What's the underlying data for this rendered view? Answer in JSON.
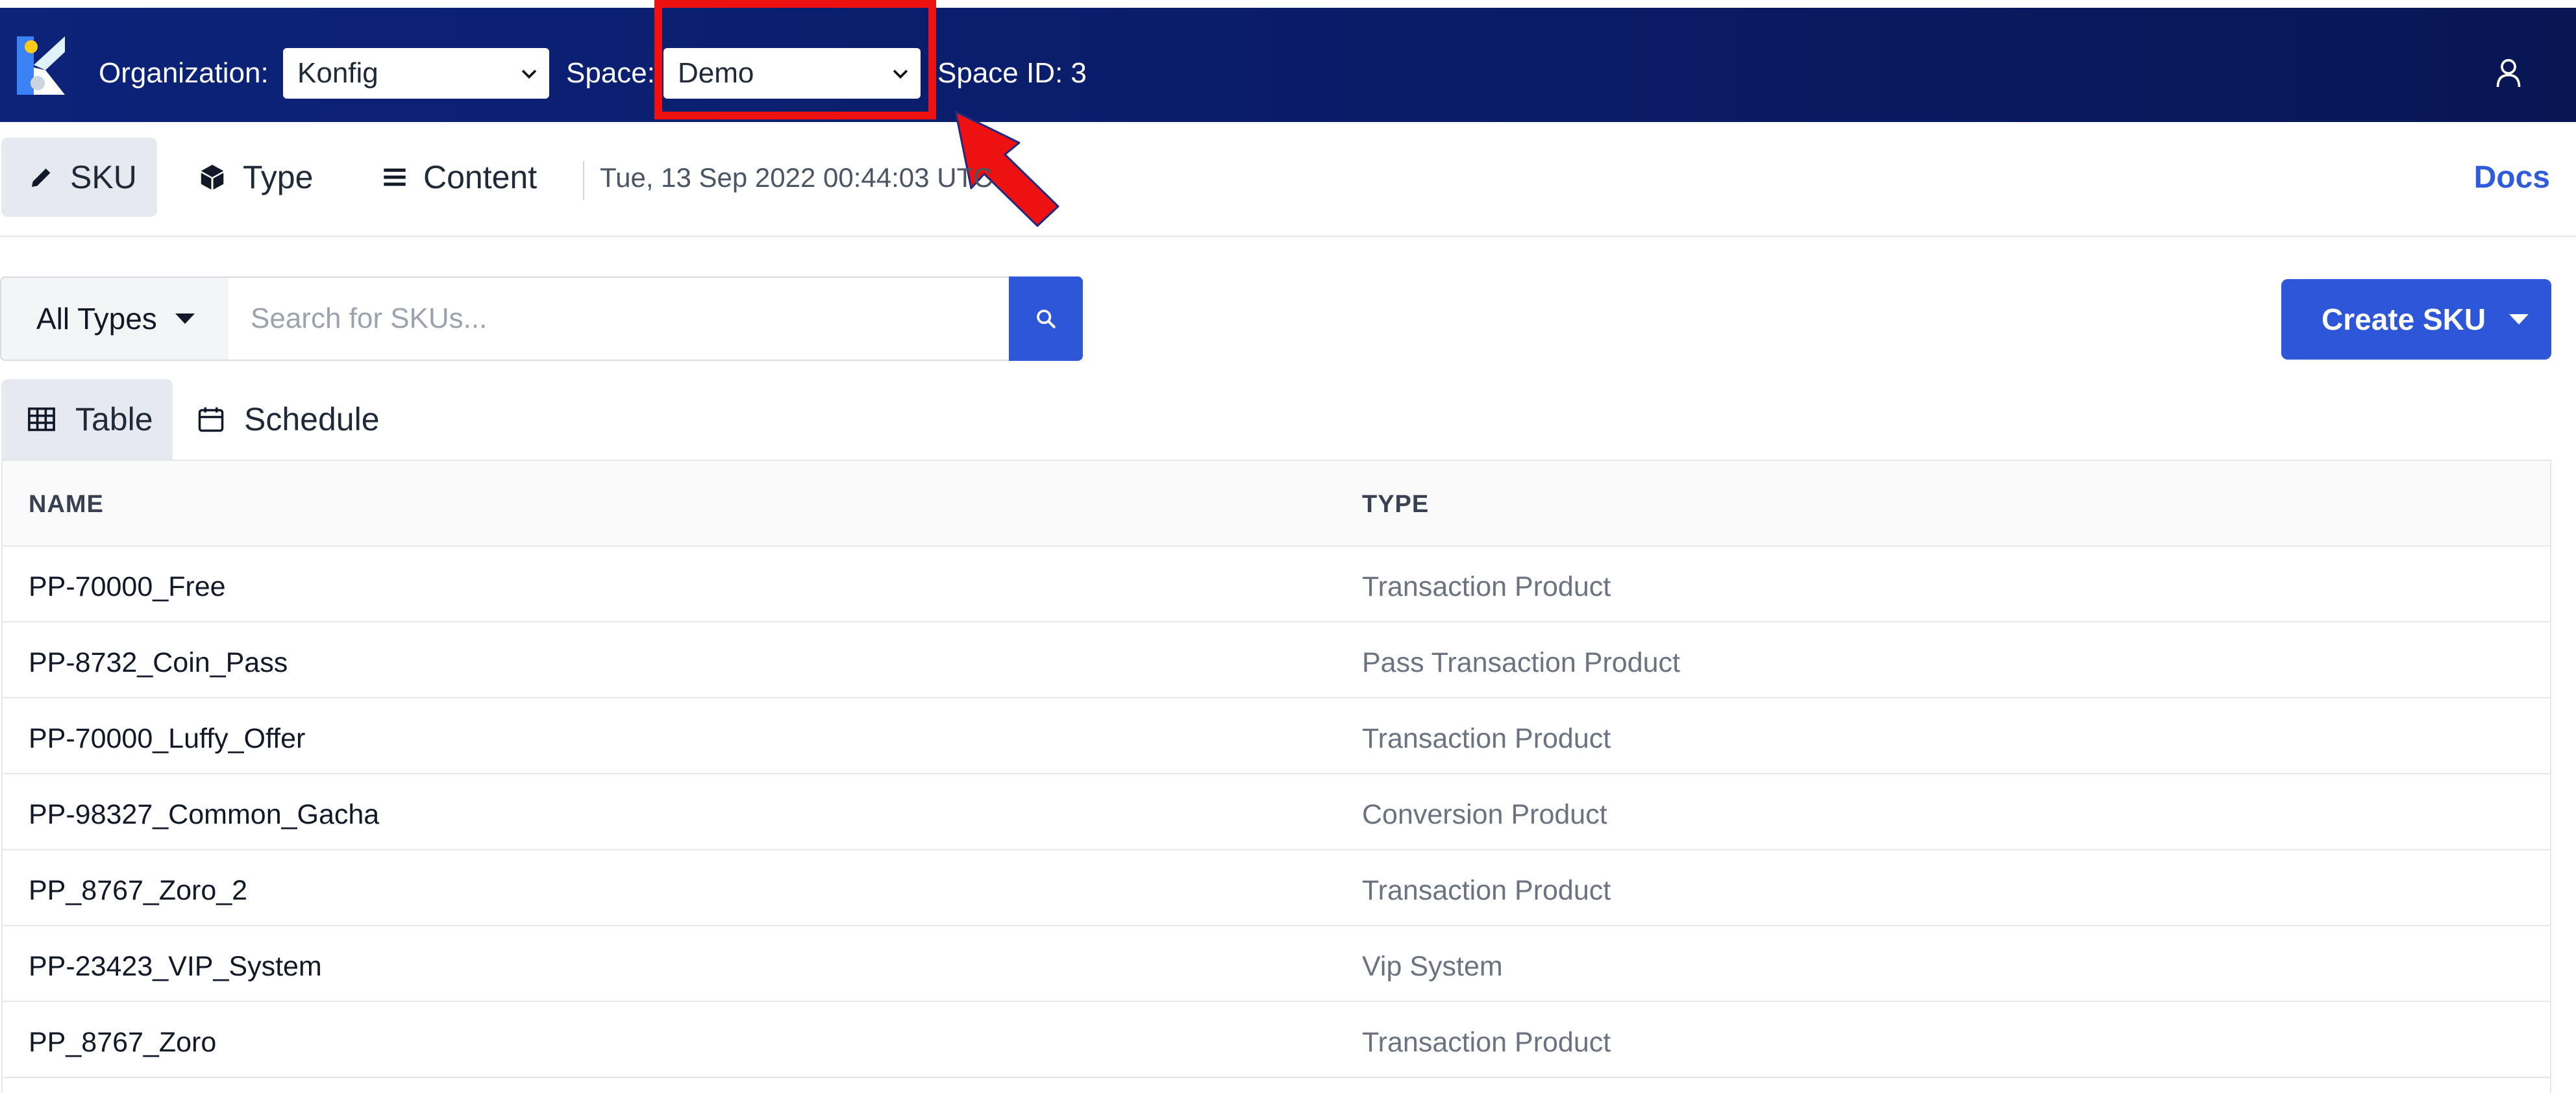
{
  "topbar": {
    "organization_label": "Organization:",
    "organization_value": "Konfig",
    "space_label": "Space:",
    "space_value": "Demo",
    "space_id": "Space ID: 3"
  },
  "nav": {
    "sku": "SKU",
    "type": "Type",
    "content": "Content",
    "timestamp": "Tue, 13 Sep 2022 00:44:03 UTC",
    "docs": "Docs"
  },
  "search": {
    "type_filter": "All Types",
    "placeholder": "Search for SKUs...",
    "create_label": "Create SKU"
  },
  "views": {
    "table": "Table",
    "schedule": "Schedule"
  },
  "table": {
    "headers": [
      "NAME",
      "TYPE"
    ],
    "rows": [
      {
        "name": "PP-70000_Free",
        "type": "Transaction Product"
      },
      {
        "name": "PP-8732_Coin_Pass",
        "type": "Pass Transaction Product"
      },
      {
        "name": "PP-70000_Luffy_Offer",
        "type": "Transaction Product"
      },
      {
        "name": "PP-98327_Common_Gacha",
        "type": "Conversion Product"
      },
      {
        "name": "PP_8767_Zoro_2",
        "type": "Transaction Product"
      },
      {
        "name": "PP-23423_VIP_System",
        "type": "Vip System"
      },
      {
        "name": "PP_8767_Zoro",
        "type": "Transaction Product"
      }
    ]
  },
  "colors": {
    "topbar": "#0c2379",
    "accent": "#2e56d9",
    "highlight": "#ee1111"
  }
}
